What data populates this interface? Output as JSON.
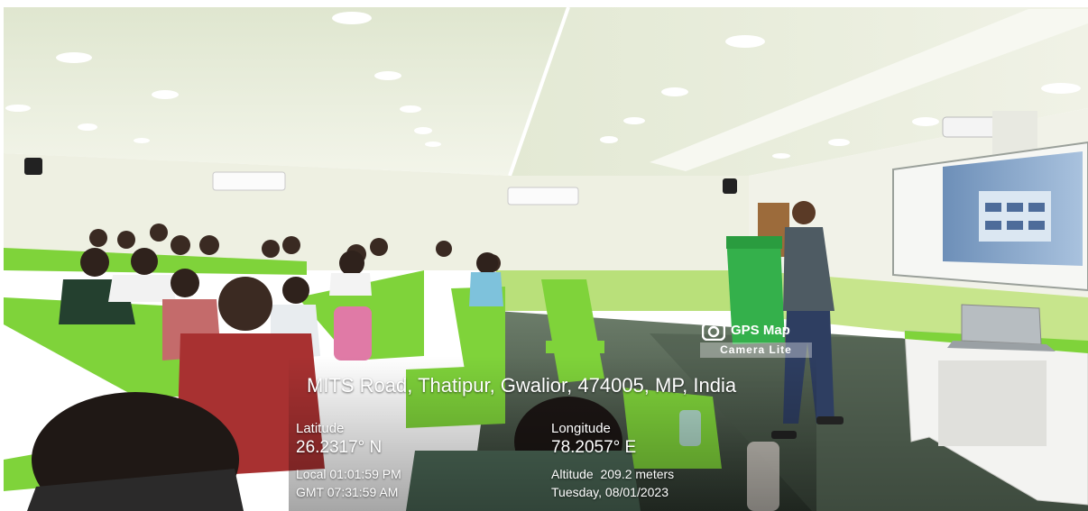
{
  "photo": {
    "description_colors": {
      "wall": "#eef0e4",
      "ceiling": "#e7ecda",
      "chair_green": "#7fd33a",
      "floor": "#3a4a3c"
    }
  },
  "overlay": {
    "brand": {
      "title": "GPS Map",
      "subtitle": "Camera Lite",
      "icon": "camera-icon"
    },
    "address": "MITS Road, Thatipur, Gwalior, 474005, MP, India",
    "latitude_label": "Latitude",
    "latitude_value": "26.2317° N",
    "longitude_label": "Longitude",
    "longitude_value": "78.2057° E",
    "local_time": "Local 01:01:59 PM",
    "gmt_time": "GMT 07:31:59 AM",
    "altitude": "Altitude  209.2 meters",
    "date": "Tuesday, 08/01/2023"
  }
}
